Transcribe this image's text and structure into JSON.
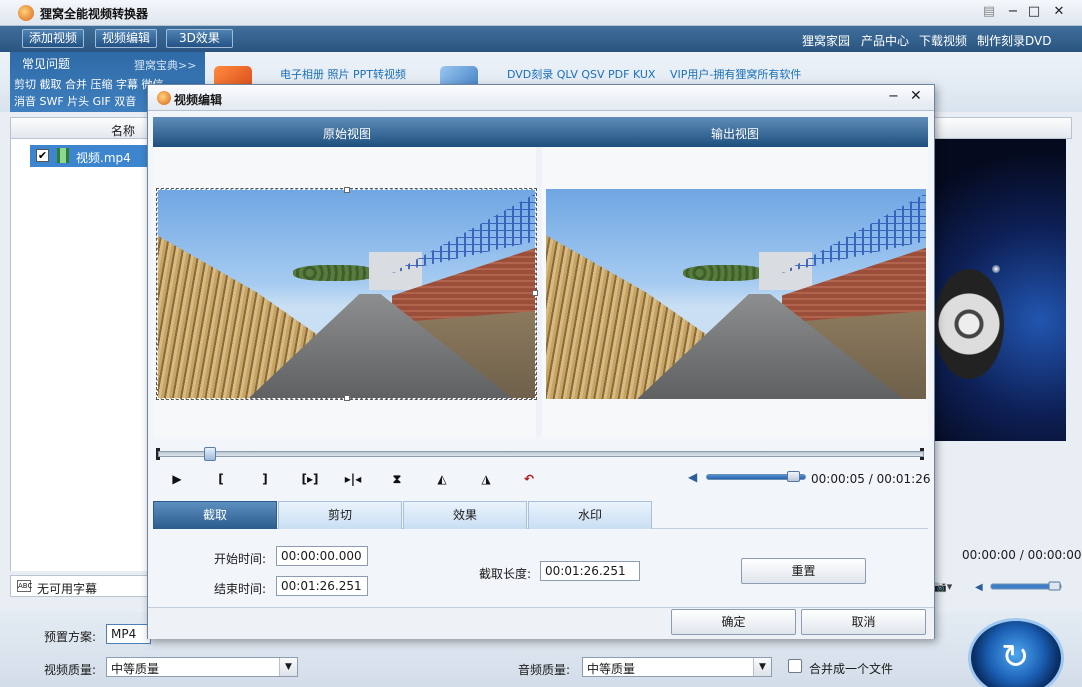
{
  "app": {
    "title": "狸窝全能视频转换器"
  },
  "toolbar": {
    "add_video": "添加视频",
    "edit_video": "视频编辑",
    "effect_3d": "3D效果",
    "links": [
      "狸窝家园",
      "产品中心",
      "下载视频",
      "制作刻录DVD"
    ]
  },
  "faq": {
    "title": "常见问题",
    "more": "狸窝宝典>>",
    "row1": "剪切 截取 合并 压缩 字幕 微信",
    "row2": "消音 SWF 片头 GIF 双音"
  },
  "promo": {
    "link1": "电子相册 照片 PPT转视频",
    "link2": "DVD刻录 QLV QSV PDF KUX",
    "link3": "VIP用户-拥有狸窝所有软件"
  },
  "file_list": {
    "header_name": "名称",
    "items": [
      {
        "name": "视频.mp4",
        "checked": true
      }
    ]
  },
  "subtitle": {
    "label": "无可用字幕"
  },
  "preview": {
    "time": "00:00:00 / 00:00:00"
  },
  "bottom": {
    "preset_label": "预置方案:",
    "preset_value": "MP4",
    "video_quality_label": "视频质量:",
    "video_quality_value": "中等质量",
    "audio_quality_label": "音频质量:",
    "audio_quality_value": "中等质量",
    "merge_label": "合并成一个文件"
  },
  "dialog": {
    "title": "视频编辑",
    "original_view": "原始视图",
    "output_view": "输出视图",
    "time_readout": "00:00:05 / 00:01:26",
    "progress_fraction": 0.06,
    "volume_fraction": 0.95,
    "controls": {
      "play": "▶",
      "mark_in": "[",
      "mark_out": "]",
      "seek_marks": "[▸]",
      "split": "▸|◂",
      "flip_v": "⧗",
      "rotate_l": "◭",
      "rotate_r": "◮",
      "undo": "↶"
    },
    "tabs": [
      "截取",
      "剪切",
      "效果",
      "水印"
    ],
    "active_tab": 0,
    "start_time_label": "开始时间:",
    "start_time_value": "00:00:00.000",
    "end_time_label": "结束时间:",
    "end_time_value": "00:01:26.251",
    "length_label": "截取长度:",
    "length_value": "00:01:26.251",
    "reset": "重置",
    "ok": "确定",
    "cancel": "取消"
  }
}
